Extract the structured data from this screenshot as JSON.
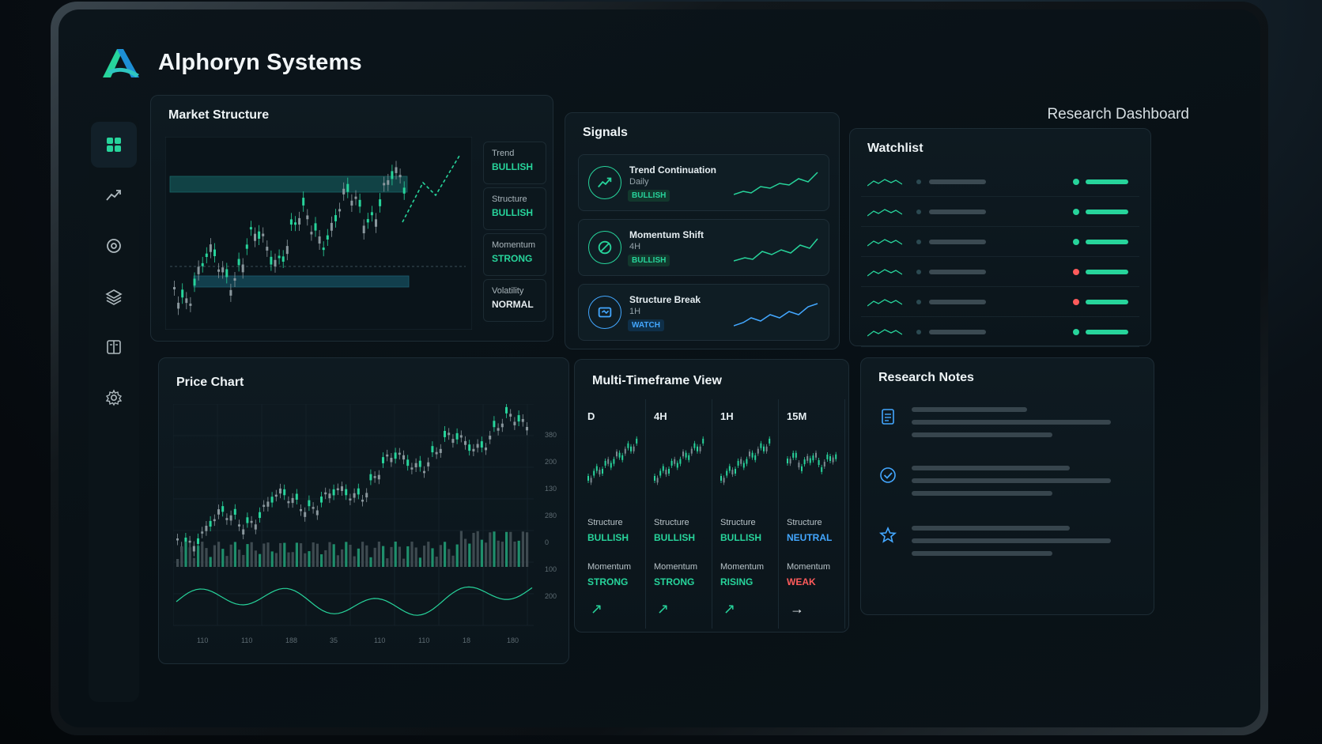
{
  "brand": {
    "name": "Alphoryn Systems"
  },
  "header": {
    "subtitle": "Research Dashboard"
  },
  "sidebar": {
    "items": [
      {
        "icon": "grid-icon",
        "active": true
      },
      {
        "icon": "trend-icon",
        "active": false
      },
      {
        "icon": "target-icon",
        "active": false
      },
      {
        "icon": "layers-icon",
        "active": false
      },
      {
        "icon": "book-icon",
        "active": false
      },
      {
        "icon": "gear-icon",
        "active": false
      }
    ]
  },
  "market_structure": {
    "title": "Market Structure",
    "stats": [
      {
        "label": "Trend",
        "value": "BULLISH",
        "tone": "green"
      },
      {
        "label": "Structure",
        "value": "BULLISH",
        "tone": "green"
      },
      {
        "label": "Momentum",
        "value": "STRONG",
        "tone": "green"
      },
      {
        "label": "Volatility",
        "value": "NORMAL",
        "tone": "white"
      }
    ]
  },
  "signals": {
    "title": "Signals",
    "items": [
      {
        "title": "Trend Continuation",
        "timeframe": "Daily",
        "badge": "BULLISH",
        "tone": "green",
        "icon": "trend-up-icon"
      },
      {
        "title": "Momentum Shift",
        "timeframe": "4H",
        "badge": "BULLISH",
        "tone": "green",
        "icon": "target-icon"
      },
      {
        "title": "Structure Break",
        "timeframe": "1H",
        "badge": "WATCH",
        "tone": "blue",
        "icon": "break-icon"
      }
    ]
  },
  "watchlist": {
    "title": "Watchlist",
    "rows": [
      {
        "status": "green"
      },
      {
        "status": "green"
      },
      {
        "status": "green"
      },
      {
        "status": "red"
      },
      {
        "status": "red"
      },
      {
        "status": "green"
      }
    ]
  },
  "price_chart": {
    "title": "Price Chart",
    "y_ticks": [
      "380",
      "200",
      "130",
      "280",
      "0",
      "100",
      "200"
    ],
    "x_ticks": [
      "110",
      "110",
      "188",
      "35",
      "110",
      "110",
      "18",
      "180"
    ]
  },
  "mtf": {
    "title": "Multi-Timeframe View",
    "columns": [
      {
        "tf": "D",
        "structure_label": "Structure",
        "structure": "BULLISH",
        "structure_tone": "green",
        "momentum_label": "Momentum",
        "momentum": "STRONG",
        "momentum_tone": "green",
        "arrow": "↗",
        "arrow_tone": "green"
      },
      {
        "tf": "4H",
        "structure_label": "Structure",
        "structure": "BULLISH",
        "structure_tone": "green",
        "momentum_label": "Momentum",
        "momentum": "STRONG",
        "momentum_tone": "green",
        "arrow": "↗",
        "arrow_tone": "green"
      },
      {
        "tf": "1H",
        "structure_label": "Structure",
        "structure": "BULLISH",
        "structure_tone": "green",
        "momentum_label": "Momentum",
        "momentum": "RISING",
        "momentum_tone": "green",
        "arrow": "↗",
        "arrow_tone": "green"
      },
      {
        "tf": "15M",
        "structure_label": "Structure",
        "structure": "NEUTRAL",
        "structure_tone": "blue",
        "momentum_label": "Momentum",
        "momentum": "WEAK",
        "momentum_tone": "red",
        "arrow": "→",
        "arrow_tone": "white"
      }
    ]
  },
  "notes": {
    "title": "Research Notes",
    "items": [
      {
        "icon": "document-icon"
      },
      {
        "icon": "check-circle-icon"
      },
      {
        "icon": "star-icon"
      }
    ]
  },
  "colors": {
    "accent": "#27d49b",
    "bearish": "#ff5b5b",
    "info": "#43a7ff",
    "bg": "#081015"
  }
}
